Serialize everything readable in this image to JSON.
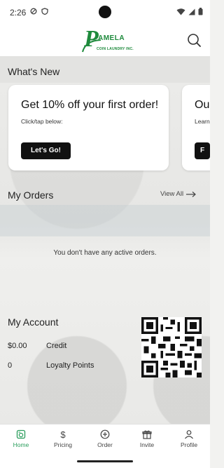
{
  "status": {
    "time": "2:26"
  },
  "header": {
    "logo_name": "AMELA",
    "logo_sub": "COIN LAUNDRY INC."
  },
  "whats_new": {
    "title": "What's New",
    "cards": [
      {
        "title": "Get 10% off your first order!",
        "subtitle": "Click/tap below:",
        "button": "Let's Go!"
      },
      {
        "title": "Our",
        "subtitle": "Learn",
        "button": "F"
      }
    ]
  },
  "orders": {
    "title": "My Orders",
    "view_all": "View All",
    "empty_text": "You don't have any active orders."
  },
  "account": {
    "title": "My Account",
    "credit_value": "$0.00",
    "credit_label": "Credit",
    "loyalty_value": "0",
    "loyalty_label": "Loyalty Points"
  },
  "nav": {
    "items": [
      {
        "label": "Home",
        "icon": "washer-icon",
        "active": true
      },
      {
        "label": "Pricing",
        "icon": "dollar-icon",
        "active": false
      },
      {
        "label": "Order",
        "icon": "plus-circle-icon",
        "active": false
      },
      {
        "label": "Invite",
        "icon": "gift-icon",
        "active": false
      },
      {
        "label": "Profile",
        "icon": "person-icon",
        "active": false
      }
    ]
  },
  "colors": {
    "accent": "#2a9d5c",
    "brand_green": "#1e8a3c",
    "button_dark": "#111111"
  }
}
